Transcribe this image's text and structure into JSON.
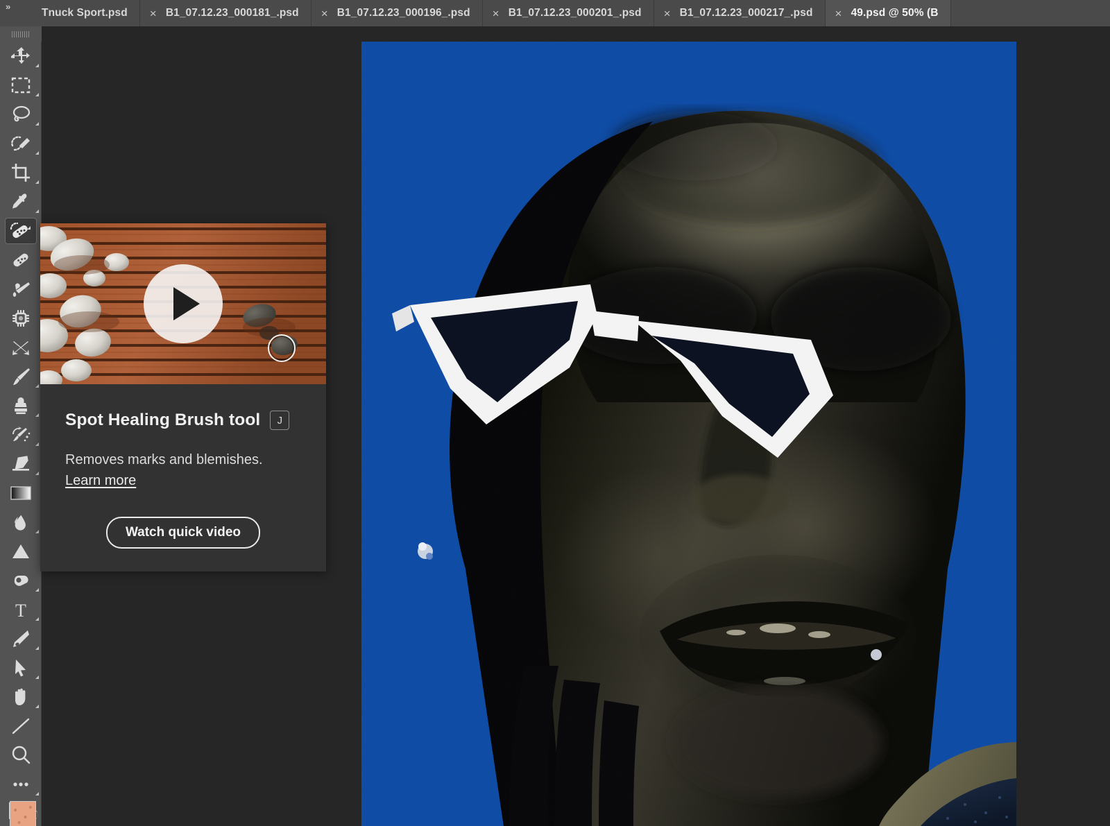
{
  "window": {
    "app": "Adobe Photoshop"
  },
  "tabbar": {
    "collapse_icon": "chevron-double-right-icon",
    "tabs": [
      {
        "label": "Tnuck Sport.psd",
        "close": "×",
        "active": false,
        "show_close": false
      },
      {
        "label": "B1_07.12.23_000181_.psd",
        "close": "×",
        "active": false,
        "show_close": true
      },
      {
        "label": "B1_07.12.23_000196_.psd",
        "close": "×",
        "active": false,
        "show_close": true
      },
      {
        "label": "B1_07.12.23_000201_.psd",
        "close": "×",
        "active": false,
        "show_close": true
      },
      {
        "label": "B1_07.12.23_000217_.psd",
        "close": "×",
        "active": false,
        "show_close": true
      },
      {
        "label": "49.psd @ 50% (B",
        "close": "×",
        "active": true,
        "show_close": true
      }
    ]
  },
  "toolbar": {
    "tools": [
      {
        "name": "move-tool",
        "icon": "move-icon",
        "has_flyout": true,
        "selected": false
      },
      {
        "name": "rectangular-marquee-tool",
        "icon": "marquee-icon",
        "has_flyout": true,
        "selected": false
      },
      {
        "name": "lasso-tool",
        "icon": "lasso-icon",
        "has_flyout": true,
        "selected": false
      },
      {
        "name": "object-selection-tool",
        "icon": "quick-selection-icon",
        "has_flyout": true,
        "selected": false
      },
      {
        "name": "crop-tool",
        "icon": "crop-icon",
        "has_flyout": true,
        "selected": false
      },
      {
        "name": "eyedropper-tool",
        "icon": "eyedropper-icon",
        "has_flyout": true,
        "selected": false
      },
      {
        "name": "spot-healing-brush-tool",
        "icon": "spot-healing-brush-icon",
        "has_flyout": true,
        "selected": true
      },
      {
        "name": "healing-brush-tool",
        "icon": "bandage-icon",
        "has_flyout": false,
        "selected": false
      },
      {
        "name": "patch-tool",
        "icon": "patch-brush-icon",
        "has_flyout": false,
        "selected": false
      },
      {
        "name": "remove-tool",
        "icon": "chip-icon",
        "has_flyout": false,
        "selected": false
      },
      {
        "name": "content-aware-move-tool",
        "icon": "crossed-arrows-icon",
        "has_flyout": false,
        "selected": false
      },
      {
        "name": "brush-tool",
        "icon": "paintbrush-icon",
        "has_flyout": true,
        "selected": false
      },
      {
        "name": "clone-stamp-tool",
        "icon": "clone-stamp-icon",
        "has_flyout": true,
        "selected": false
      },
      {
        "name": "history-brush-tool",
        "icon": "history-brush-icon",
        "has_flyout": true,
        "selected": false
      },
      {
        "name": "eraser-tool",
        "icon": "eraser-icon",
        "has_flyout": true,
        "selected": false
      },
      {
        "name": "gradient-tool",
        "icon": "gradient-icon",
        "has_flyout": true,
        "selected": false
      },
      {
        "name": "blur-tool",
        "icon": "blur-drop-icon",
        "has_flyout": true,
        "selected": false
      },
      {
        "name": "dodge-tool",
        "icon": "sharpen-triangle-icon",
        "has_flyout": true,
        "selected": false
      },
      {
        "name": "burn-tool",
        "icon": "dodge-burn-icon",
        "has_flyout": true,
        "selected": false
      },
      {
        "name": "horizontal-type-tool",
        "icon": "type-t-icon",
        "has_flyout": true,
        "selected": false
      },
      {
        "name": "pen-tool",
        "icon": "pen-icon",
        "has_flyout": true,
        "selected": false
      },
      {
        "name": "path-selection-tool",
        "icon": "path-arrow-icon",
        "has_flyout": true,
        "selected": false
      },
      {
        "name": "hand-tool",
        "icon": "hand-icon",
        "has_flyout": true,
        "selected": false
      },
      {
        "name": "line-tool",
        "icon": "line-icon",
        "has_flyout": false,
        "selected": false
      },
      {
        "name": "zoom-tool",
        "icon": "magnifier-icon",
        "has_flyout": false,
        "selected": false
      },
      {
        "name": "edit-toolbar-tool",
        "icon": "ellipsis-icon",
        "has_flyout": true,
        "selected": false
      }
    ],
    "colors": {
      "foreground": "#000000",
      "background": "#ffffff",
      "reset_icon": "reset-colors-icon",
      "quick_swatch": "#e8a382"
    }
  },
  "tooltip": {
    "media": {
      "thumbnail": "wood-deck-with-stones-video-thumbnail",
      "play_icon": "play-triangle-icon",
      "cursor_icon": "brush-cursor-circle-icon"
    },
    "title": "Spot Healing Brush tool",
    "shortcut_key": "J",
    "description": "Removes marks and blemishes.",
    "learn_more_label": "Learn more",
    "cta_label": "Watch quick video"
  },
  "canvas": {
    "document_label": "49.psd @ 50% (B",
    "zoom_level": "50%",
    "image_description": "portrait-with-white-cat-eye-sunglasses-on-blue-background",
    "background_color": "#0d4ba5"
  },
  "theme": {
    "tabbar_bg": "#4a4a4a",
    "tab_active_bg": "#545454",
    "toolbar_bg": "#535353",
    "workspace_bg": "#262626",
    "panel_bg": "#323232",
    "text": "#e8e8e8"
  }
}
